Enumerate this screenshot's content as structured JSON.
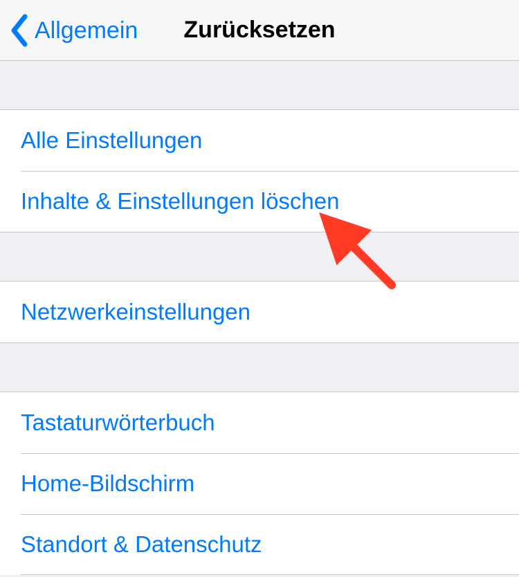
{
  "nav": {
    "back_label": "Allgemein",
    "title": "Zurücksetzen"
  },
  "groups": [
    {
      "items": [
        {
          "label": "Alle Einstellungen",
          "name": "reset-all-settings"
        },
        {
          "label": "Inhalte & Einstellungen löschen",
          "name": "erase-content-settings"
        }
      ]
    },
    {
      "items": [
        {
          "label": "Netzwerkeinstellungen",
          "name": "reset-network-settings"
        }
      ]
    },
    {
      "items": [
        {
          "label": "Tastaturwörterbuch",
          "name": "reset-keyboard-dictionary"
        },
        {
          "label": "Home-Bildschirm",
          "name": "reset-home-screen"
        },
        {
          "label": "Standort & Datenschutz",
          "name": "reset-location-privacy"
        }
      ]
    }
  ],
  "colors": {
    "accent": "#007aff",
    "annotation": "#ff3b25"
  }
}
